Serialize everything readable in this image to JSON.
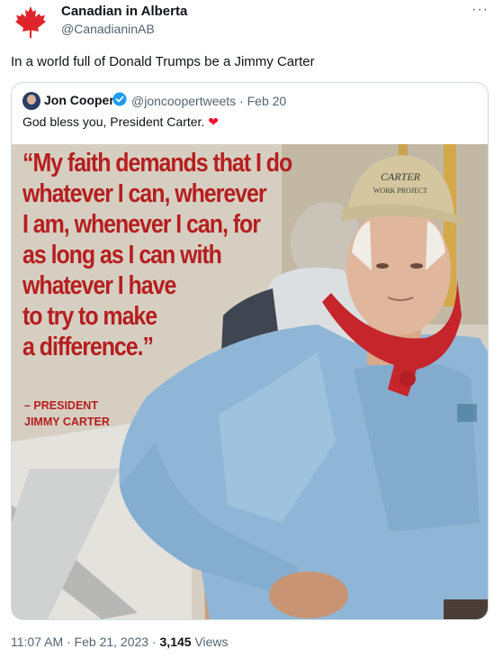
{
  "tweet": {
    "author_name": "Canadian in Alberta",
    "author_handle": "@CanadianinAB",
    "more_icon": "more-dots-icon",
    "avatar_icon": "maple-leaf-icon",
    "text": "In a world full of Donald Trumps be a Jimmy Carter",
    "timestamp": "11:07 AM · Feb 21, 2023 · ",
    "views_count": "3,145",
    "views_label": " Views"
  },
  "quoted": {
    "author_name": "Jon Cooper",
    "verified_icon": "verified-badge-icon",
    "handle_date": "@joncoopertweets · Feb 20",
    "text": "God bless you, President Carter.",
    "emoji": "❤",
    "image": {
      "quote": "“My faith demands that I do\nwhatever I can, wherever\nI am, whenever I can, for\nas long as I can with\nwhatever I have\nto try to make\na difference.”",
      "attribution": "– PRESIDENT\nJIMMY CARTER",
      "cap_text": "CARTER\nWORK PROJECT"
    }
  },
  "colors": {
    "quote_red": "#b61e1f",
    "maple_red": "#e0242b",
    "heart_red": "#f0142f",
    "verified_blue": "#1d9bf0",
    "shirt_blue": "#8fb6d6"
  }
}
